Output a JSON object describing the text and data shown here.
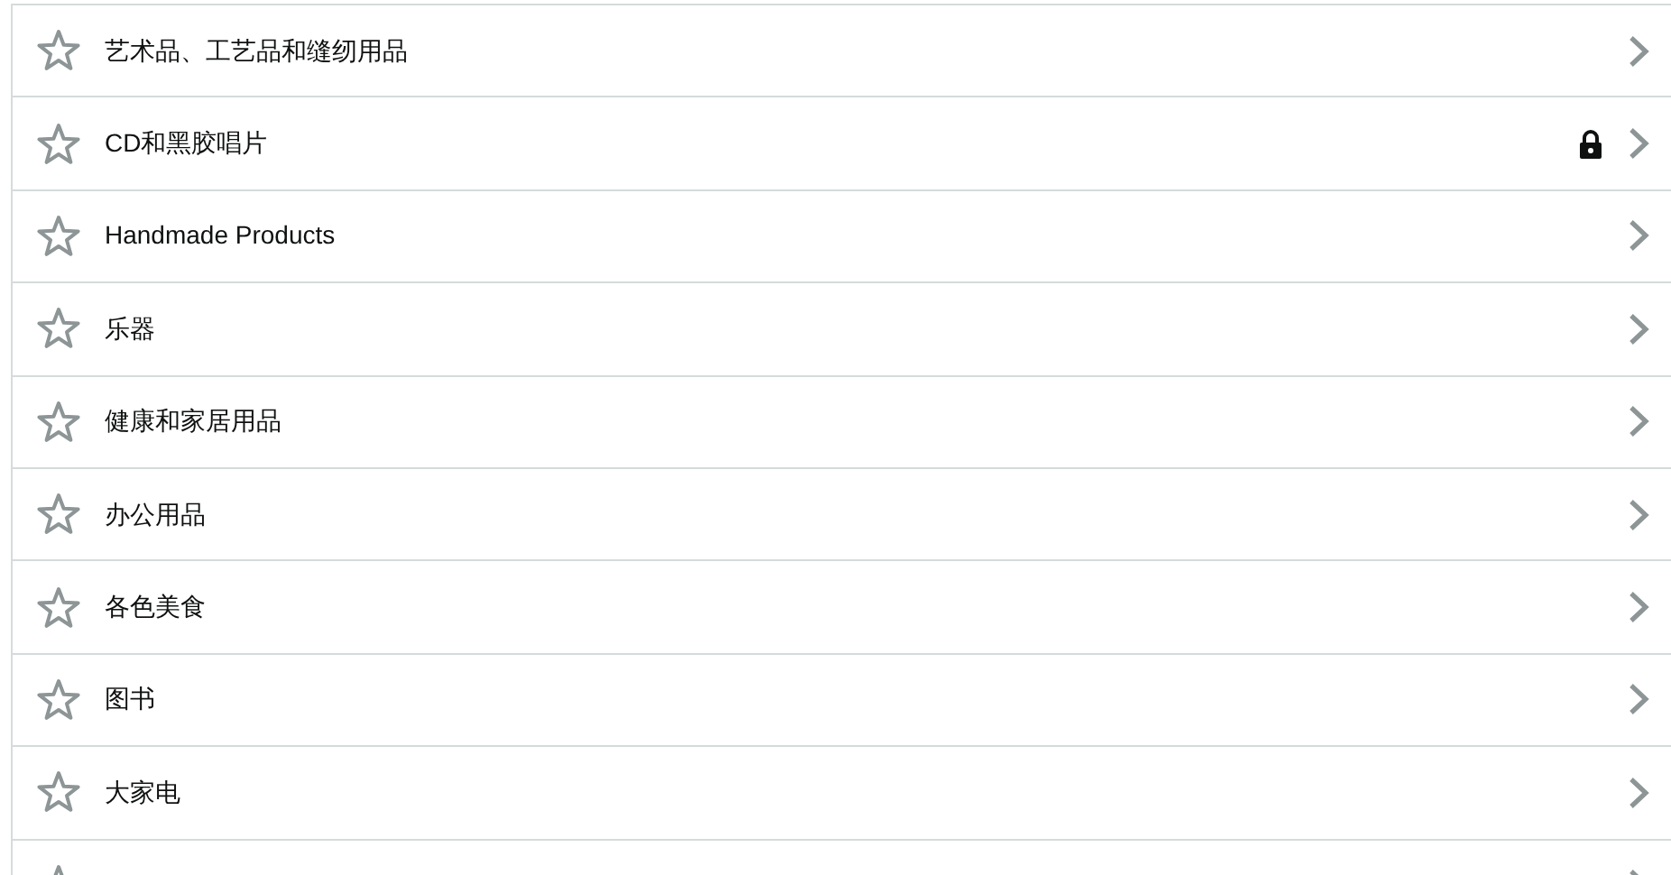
{
  "items": [
    {
      "label": "艺术品、工艺品和缝纫用品",
      "locked": false
    },
    {
      "label": "CD和黑胶唱片",
      "locked": true
    },
    {
      "label": "Handmade Products",
      "locked": false
    },
    {
      "label": "乐器",
      "locked": false
    },
    {
      "label": "健康和家居用品",
      "locked": false
    },
    {
      "label": "办公用品",
      "locked": false
    },
    {
      "label": "各色美食",
      "locked": false
    },
    {
      "label": "图书",
      "locked": false
    },
    {
      "label": "大家电",
      "locked": false
    },
    {
      "locked": false
    }
  ]
}
